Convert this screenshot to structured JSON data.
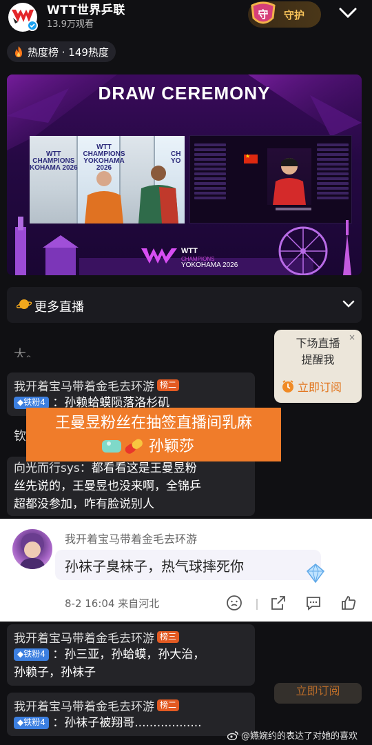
{
  "header": {
    "channel_name": "WTT世界乒联",
    "viewers": "13.9万观看",
    "guard_label": "守护",
    "guard_shield_char": "守"
  },
  "hot": {
    "label": "热度榜 · 149热度"
  },
  "video": {
    "title": "DRAW CEREMONY",
    "stage_text_left": "WTT\nCHAMPIONS\nYOKOHAMA 2026",
    "logo_name": "WTT",
    "logo_sub": "CHAMPIONS",
    "logo_city": "YOKOHAMA 2026"
  },
  "more_live": {
    "label": "更多直播"
  },
  "chat": {
    "fragment": "大。",
    "comments": [
      {
        "name": "我开着宝马带着金毛去环游",
        "rank": "榜二",
        "fan": "铁粉4",
        "text": "孙赖蛤蟆陨落洛杉矶"
      },
      {
        "name": "我开着宝马带着金毛去环游",
        "rank": "榜三",
        "fan": "铁粉4",
        "text": "孙三亚，孙蛤蟆，孙大治，",
        "text2": "孙赖子，孙袜子"
      },
      {
        "name": "我开着宝马带着金毛去环游",
        "rank": "榜二",
        "fan": "铁粉4",
        "text": "孙袜子被翔哥.................."
      }
    ],
    "cut_text": "钦",
    "long_msg_user": "向光而行sys：",
    "long_msg_line1": "都看看这是王曼昱粉",
    "long_msg_line2": "丝先说的，王曼昱也没来啊，全锦乒",
    "long_msg_line3": "超都没参加，咋有脸说别人"
  },
  "reminder": {
    "line1": "下场直播",
    "line2": "提醒我",
    "button": "立即订阅",
    "close": "×"
  },
  "overlay": {
    "line1": "王曼昱粉丝在抽签直播间乳麻",
    "line2": "孙颖莎"
  },
  "reply": {
    "user": "我开着宝马带着金毛去环游",
    "text": "孙袜子臭袜子，热气球摔死你",
    "meta": "8-2 16:04  来自河北"
  },
  "watermark": {
    "text": "@嬿婉约的表达了对她的喜欢"
  },
  "colors": {
    "accent_orange": "#f07c2a",
    "rank_badge": "#e25a22",
    "fan_badge": "#3c7fe0",
    "gold": "#f7c35a"
  }
}
